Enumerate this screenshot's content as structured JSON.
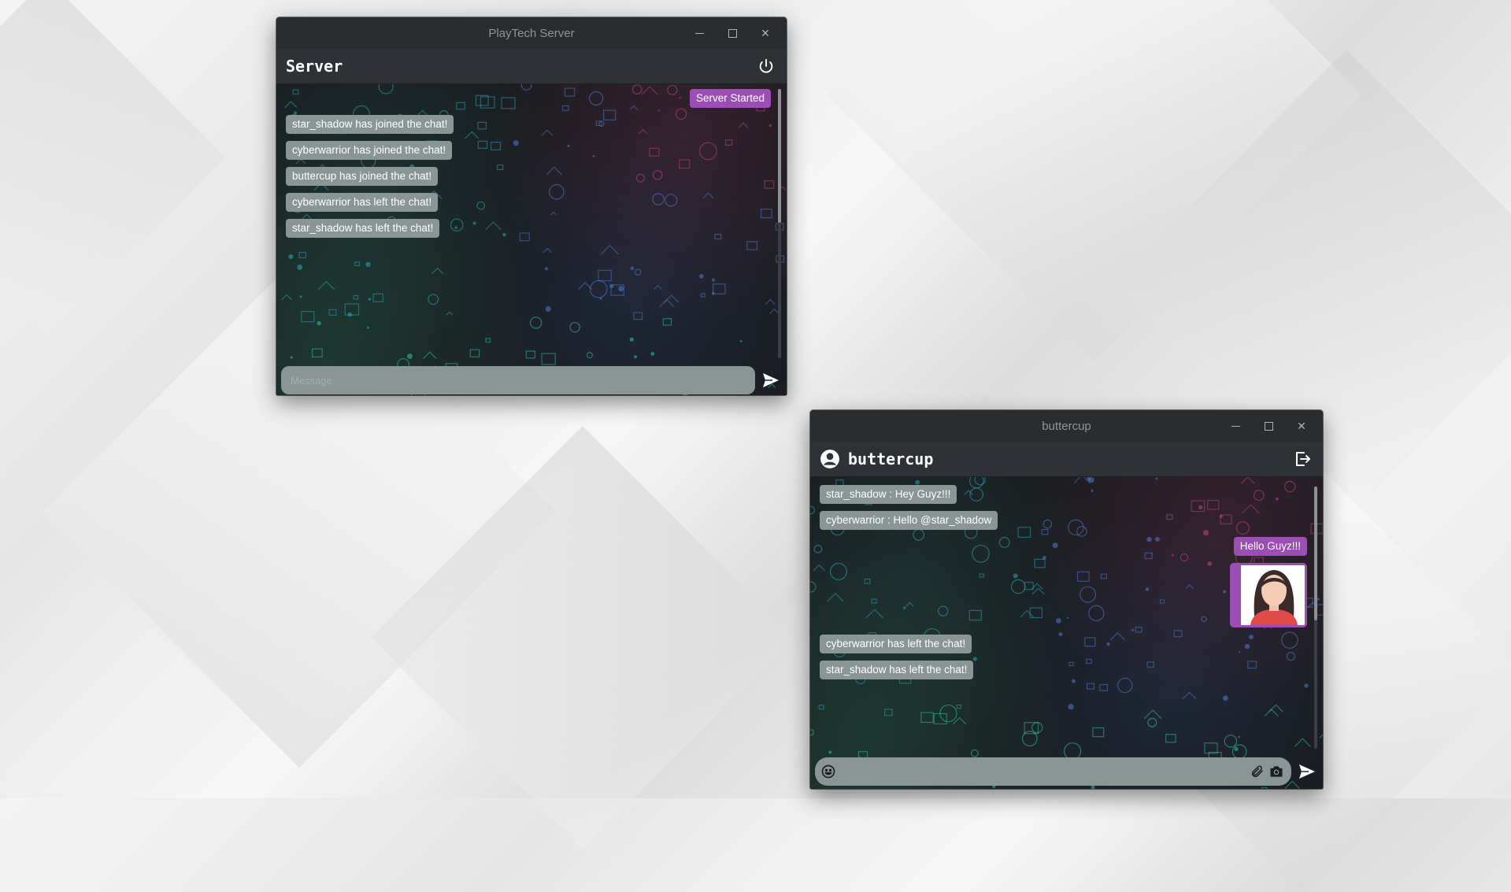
{
  "server_window": {
    "title": "PlayTech Server",
    "header_title": "Server",
    "messages": [
      {
        "text": "Server Started",
        "side": "right",
        "color": "#9b4fb5"
      },
      {
        "text": "star_shadow has joined the chat!",
        "side": "left"
      },
      {
        "text": "cyberwarrior has joined the chat!",
        "side": "left"
      },
      {
        "text": "buttercup has joined the chat!",
        "side": "left"
      },
      {
        "text": "cyberwarrior has left the chat!",
        "side": "left"
      },
      {
        "text": "star_shadow has left the chat!",
        "side": "left"
      }
    ],
    "input_placeholder": "Message",
    "header_icon": "power-icon"
  },
  "client_window": {
    "title": "buttercup",
    "header_title": "buttercup",
    "messages": [
      {
        "text": "star_shadow : Hey Guyz!!!",
        "side": "left"
      },
      {
        "text": "cyberwarrior : Hello @star_shadow",
        "side": "left"
      },
      {
        "text": "Hello Guyz!!!",
        "side": "right",
        "color": "#9b4fb5"
      },
      {
        "image": "avatar-woman-image",
        "side": "right"
      },
      {
        "text": "cyberwarrior has left the chat!",
        "side": "left"
      },
      {
        "text": "star_shadow has left the chat!",
        "side": "left"
      }
    ],
    "input_placeholder": "",
    "header_icons": [
      "user-circle-icon",
      "logout-icon"
    ],
    "input_icons": [
      "emoji-icon",
      "paperclip-icon",
      "camera-icon",
      "send-icon"
    ]
  },
  "colors": {
    "bubble_gray": "#8a9596",
    "bubble_purple": "#9b4fb5",
    "header_bg": "#2e3236",
    "titlebar_bg": "#2a2d30"
  }
}
